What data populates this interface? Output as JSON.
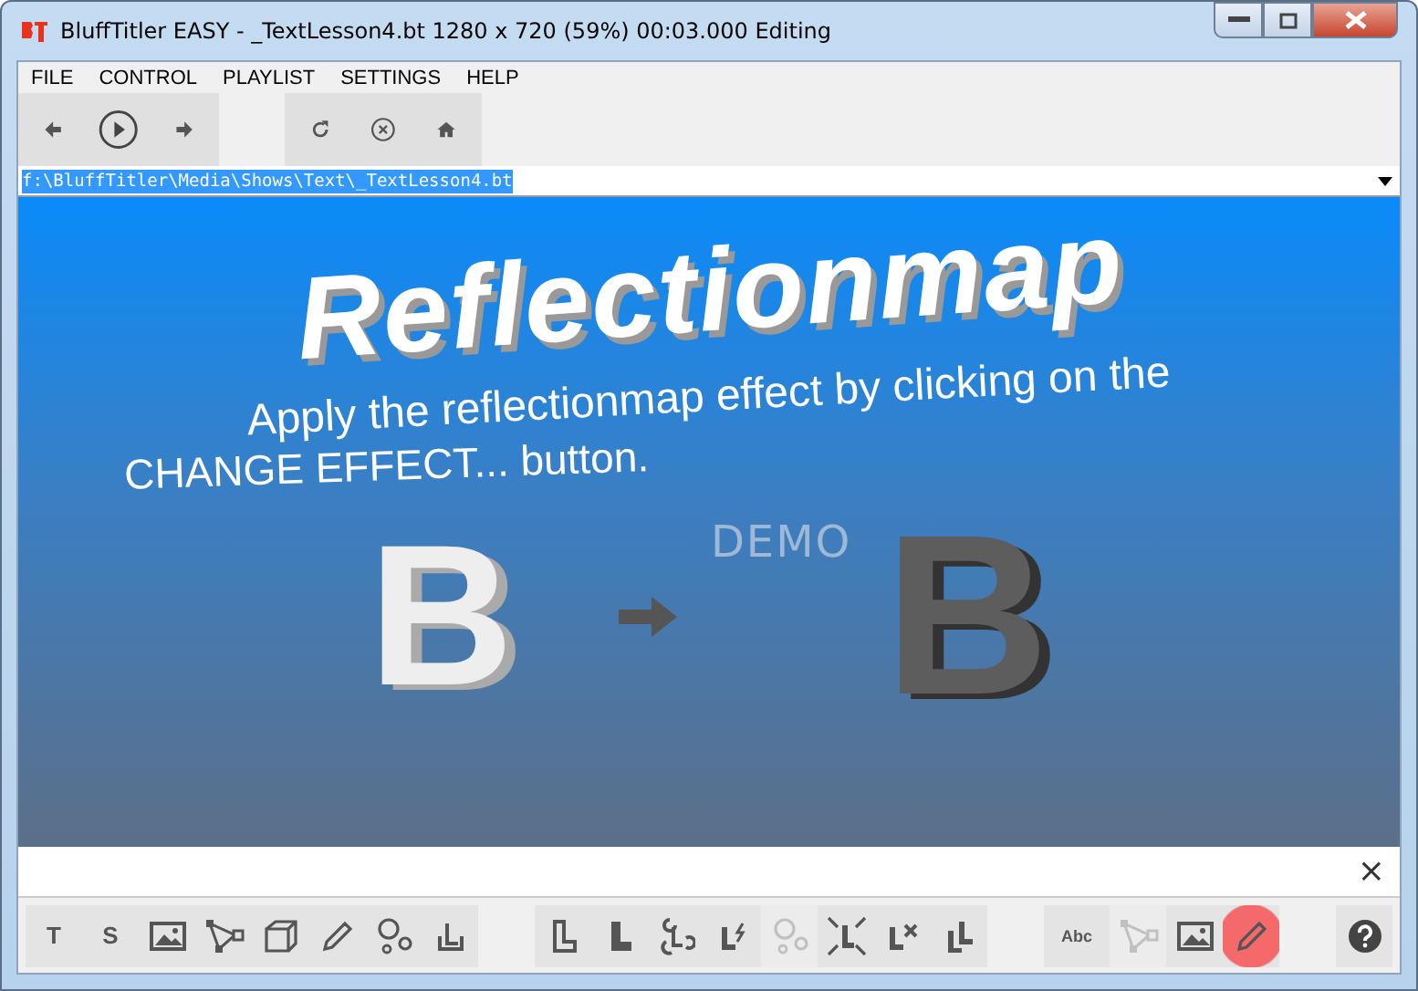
{
  "window": {
    "title": "BluffTitler EASY  - _TextLesson4.bt 1280 x 720 (59%) 00:03.000 Editing"
  },
  "menu": [
    "FILE",
    "CONTROL",
    "PLAYLIST",
    "SETTINGS",
    "HELP"
  ],
  "path": {
    "value": "f:\\BluffTitler\\Media\\Shows\\Text\\_TextLesson4.bt"
  },
  "preview": {
    "heading": "Reflectionmap",
    "line_1": "Apply the reflectionmap effect by clicking on the",
    "line_2": "CHANGE EFFECT... button.",
    "watermark": "DEMO",
    "letter_before": "B",
    "letter_after": "B"
  },
  "strip": {
    "close": "×"
  },
  "bottom_toolbar": [
    {
      "kind": "text",
      "label": "T",
      "disabled": false,
      "selected": false
    },
    {
      "kind": "text",
      "label": "S",
      "disabled": false,
      "selected": false
    },
    {
      "kind": "picture",
      "disabled": false,
      "selected": false
    },
    {
      "kind": "nodes",
      "disabled": false,
      "selected": false
    },
    {
      "kind": "cube",
      "disabled": false,
      "selected": false
    },
    {
      "kind": "pencil",
      "disabled": false,
      "selected": false
    },
    {
      "kind": "circles",
      "disabled": false,
      "selected": false
    },
    {
      "kind": "bracket",
      "disabled": false,
      "selected": false
    },
    {
      "kind": "gap"
    },
    {
      "kind": "l-outline",
      "disabled": false,
      "selected": false
    },
    {
      "kind": "l-solid",
      "disabled": false,
      "selected": false
    },
    {
      "kind": "l-loop",
      "disabled": false,
      "selected": false
    },
    {
      "kind": "l-bolt",
      "disabled": false,
      "selected": false
    },
    {
      "kind": "circles",
      "disabled": true,
      "selected": false
    },
    {
      "kind": "l-arrows",
      "disabled": false,
      "selected": false
    },
    {
      "kind": "l-cross",
      "disabled": false,
      "selected": false
    },
    {
      "kind": "l-double",
      "disabled": false,
      "selected": false
    },
    {
      "kind": "gap"
    },
    {
      "kind": "text-resize",
      "label": "Abc",
      "disabled": false,
      "selected": false
    },
    {
      "kind": "nodes",
      "disabled": true,
      "selected": false
    },
    {
      "kind": "picture",
      "disabled": false,
      "selected": false
    },
    {
      "kind": "pencil",
      "disabled": false,
      "selected": true
    },
    {
      "kind": "gap"
    },
    {
      "kind": "help",
      "disabled": false,
      "selected": false
    }
  ]
}
